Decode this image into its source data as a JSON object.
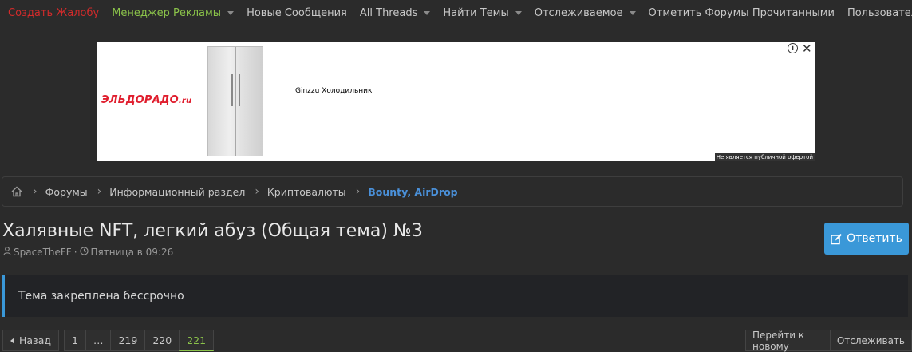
{
  "nav": {
    "items": [
      {
        "label": "Создать Жалобу",
        "color": "#d22b2b",
        "caret": false
      },
      {
        "label": "Менеджер Рекламы",
        "color": "#8bc34a",
        "caret": true
      },
      {
        "label": "Новые Сообщения",
        "color": "#c8c8c8",
        "caret": false
      },
      {
        "label": "All Threads",
        "color": "#c8c8c8",
        "caret": true
      },
      {
        "label": "Найти Темы",
        "color": "#c8c8c8",
        "caret": true
      },
      {
        "label": "Отслеживаемое",
        "color": "#c8c8c8",
        "caret": true
      },
      {
        "label": "Отметить Форумы Прочитанными",
        "color": "#c8c8c8",
        "caret": false
      },
      {
        "label": "Пользователи",
        "color": "#c8c8c8",
        "caret": true
      }
    ]
  },
  "ad": {
    "logo_main": "ЭЛЬДОРАДО",
    "logo_suffix": ".ru",
    "title": "Ginzzu Холодильник",
    "info": "i",
    "close": "✕",
    "note": "Не является публичной офертой"
  },
  "breadcrumb": {
    "items": [
      "Форумы",
      "Информационный раздел",
      "Криптовалюты",
      "Bounty, AirDrop"
    ]
  },
  "thread": {
    "title": "Халявные NFT, легкий абуз (Общая тема) №3",
    "author": "SpaceTheFF",
    "separator": "·",
    "date": "Пятница в 09:26",
    "reply_label": "Ответить"
  },
  "notice": {
    "text": "Тема закреплена бессрочно"
  },
  "pagination": {
    "prev_label": "Назад",
    "pages": [
      "1",
      "…",
      "219",
      "220",
      "221"
    ],
    "current": "221",
    "goto_new_label": "Перейти к новому",
    "watch_label": "Отслеживать"
  },
  "colors": {
    "accent": "#3a98d8",
    "green": "#8bc34a",
    "red": "#d22b2b",
    "background": "#2b2b2b"
  }
}
